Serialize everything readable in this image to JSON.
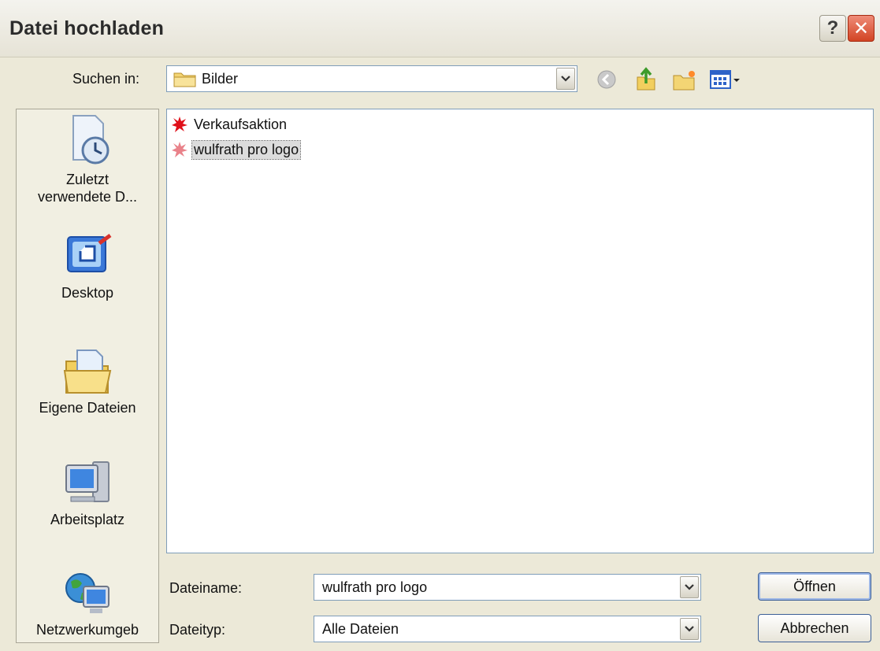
{
  "window": {
    "title": "Datei hochladen"
  },
  "title_buttons": {
    "help": "?",
    "close": "✕"
  },
  "lookin": {
    "label": "Suchen in:",
    "value": "Bilder"
  },
  "nav_icons": [
    "back-icon",
    "up-folder-icon",
    "new-folder-icon",
    "view-menu-icon"
  ],
  "places": [
    {
      "label1": "Zuletzt",
      "label2": "verwendete D...",
      "icon": "recent-documents-icon"
    },
    {
      "label1": "Desktop",
      "icon": "desktop-icon"
    },
    {
      "label1": "Eigene Dateien",
      "icon": "my-documents-icon"
    },
    {
      "label1": "Arbeitsplatz",
      "icon": "my-computer-icon"
    },
    {
      "label1": "Netzwerkumgeb",
      "icon": "network-icon"
    }
  ],
  "files": [
    {
      "name": "Verkaufsaktion",
      "selected": false
    },
    {
      "name": "wulfrath pro logo",
      "selected": true
    }
  ],
  "filename": {
    "label": "Dateiname:",
    "value": "wulfrath pro logo"
  },
  "filetype": {
    "label": "Dateityp:",
    "value": "Alle Dateien"
  },
  "buttons": {
    "open": "Öffnen",
    "cancel": "Abbrechen"
  },
  "colors": {
    "background": "#ece9d8",
    "close_red": "#d24424",
    "field_border": "#7f9db9",
    "file_icon_red": "#e0101a"
  }
}
